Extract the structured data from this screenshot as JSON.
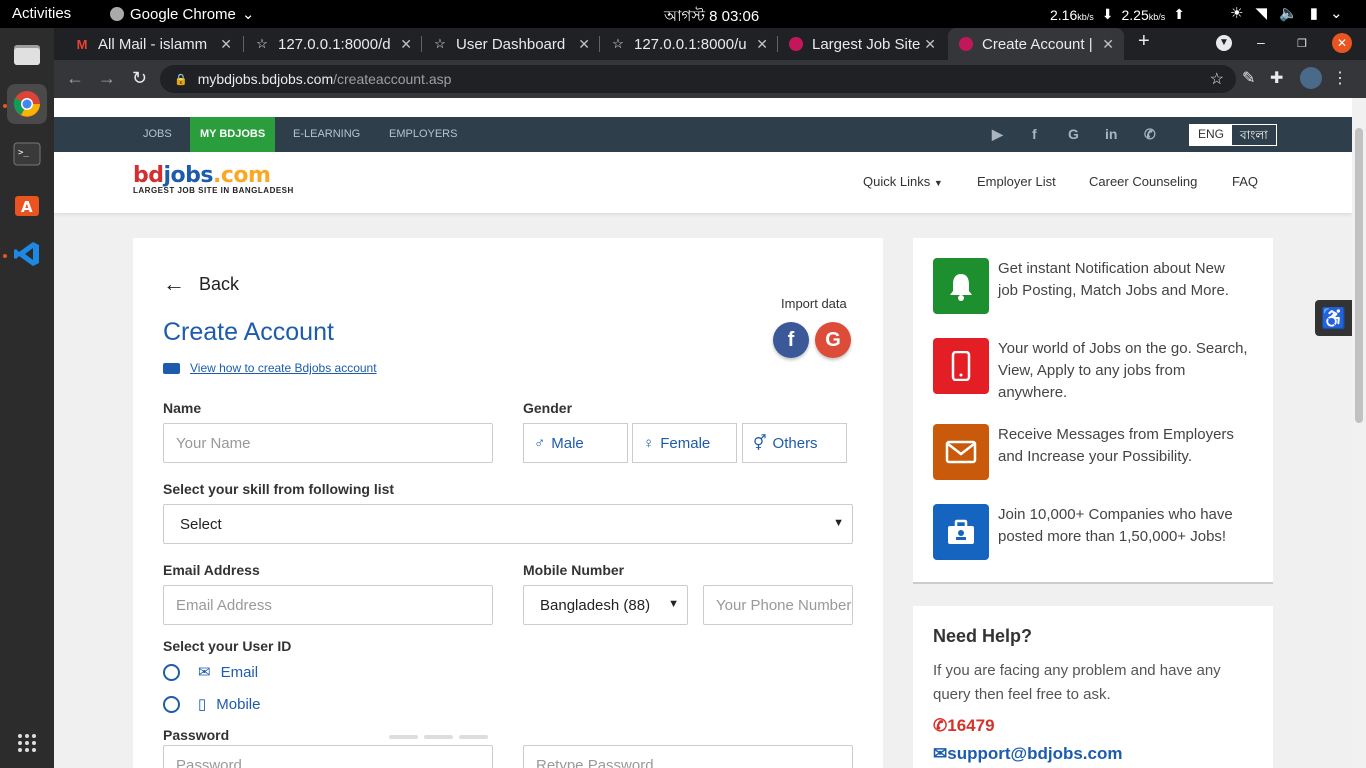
{
  "os": {
    "activities": "Activities",
    "app_name": "Google Chrome",
    "clock": "আগস্ট 8  03:06",
    "net_down": "2.16",
    "net_up": "2.25",
    "net_unit": "kb/s"
  },
  "browser": {
    "tabs": [
      {
        "title": "All Mail - islamm",
        "icon": "gmail-icon"
      },
      {
        "title": "127.0.0.1:8000/d",
        "icon": "star-icon"
      },
      {
        "title": "User Dashboard",
        "icon": "star-icon"
      },
      {
        "title": "127.0.0.1:8000/u",
        "icon": "star-icon"
      },
      {
        "title": "Largest Job Site",
        "icon": "bdjobs-icon"
      },
      {
        "title": "Create Account |",
        "icon": "bdjobs-icon"
      }
    ],
    "url_host": "mybdjobs.bdjobs.com",
    "url_path": "/createaccount.asp"
  },
  "site": {
    "nav": [
      "JOBS",
      "MY BDJOBS",
      "E-LEARNING",
      "EMPLOYERS"
    ],
    "lang_en": "ENG",
    "lang_bn": "বাংলা",
    "logo_text": "bdjobs.com",
    "logo_tagline": "LARGEST JOB SITE IN BANGLADESH",
    "header_links": [
      "Quick Links",
      "Employer List",
      "Career Counseling",
      "FAQ"
    ],
    "brand_colors": {
      "primary": "#1d5cad",
      "green": "#2a9d3c",
      "navbar": "#2e3e4a"
    }
  },
  "form": {
    "back": "Back",
    "import_label": "Import data",
    "title": "Create Account",
    "video_link": "View how to create Bdjobs account",
    "name_label": "Name",
    "name_placeholder": "Your Name",
    "gender_label": "Gender",
    "gender_options": [
      "Male",
      "Female",
      "Others"
    ],
    "skill_label": "Select your skill from following list",
    "skill_value": "Select",
    "email_label": "Email Address",
    "email_placeholder": "Email Address",
    "mobile_label": "Mobile Number",
    "country_value": "Bangladesh (88)",
    "phone_placeholder": "Your Phone Number",
    "userid_label": "Select your User ID",
    "userid_options": [
      "Email",
      "Mobile"
    ],
    "password_label": "Password",
    "password_placeholder": "Password",
    "retype_placeholder": "Retype Password"
  },
  "sidebar": {
    "features": [
      {
        "text": "Get instant Notification about New job Posting, Match Jobs and More.",
        "icon": "bell-icon",
        "color": "#1e8f2f"
      },
      {
        "text": "Your world of Jobs on the go. Search, View, Apply to any jobs from anywhere.",
        "icon": "mobile-icon",
        "color": "#e31e24"
      },
      {
        "text": "Receive Messages from Employers and Increase your Possibility.",
        "icon": "envelope-icon",
        "color": "#c95a0c"
      },
      {
        "text": "Join 10,000+ Companies who have posted more than 1,50,000+ Jobs!",
        "icon": "briefcase-icon",
        "color": "#1565c0"
      }
    ],
    "help_title": "Need Help?",
    "help_text": "If you are facing any problem and have any query then feel free to ask.",
    "help_phone": "16479",
    "help_email": "support@bdjobs.com"
  }
}
